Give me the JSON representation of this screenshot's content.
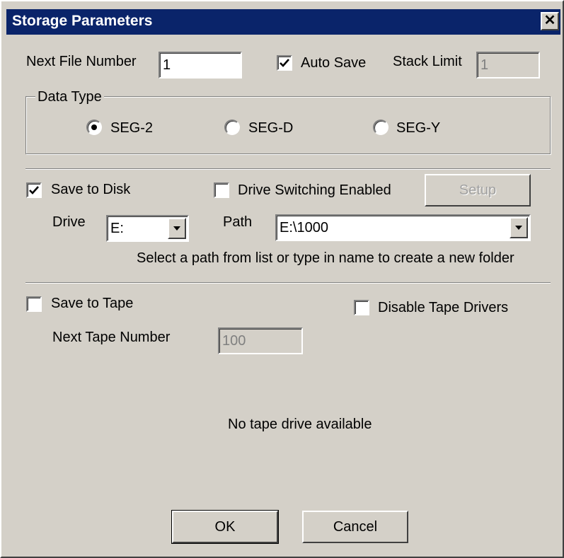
{
  "window": {
    "title": "Storage Parameters",
    "close_glyph": "✕"
  },
  "file": {
    "next_file_label": "Next File Number",
    "next_file_value": "1",
    "auto_save_label": "Auto Save",
    "auto_save_checked": true,
    "stack_limit_label": "Stack Limit",
    "stack_limit_value": "1"
  },
  "data_type": {
    "label": "Data Type",
    "selected": "SEG-2",
    "options": [
      "SEG-2",
      "SEG-D",
      "SEG-Y"
    ]
  },
  "disk": {
    "save_label": "Save to Disk",
    "save_checked": true,
    "drive_switch_label": "Drive Switching Enabled",
    "drive_switch_checked": false,
    "setup_label": "Setup",
    "drive_label": "Drive",
    "drive_value": "E:",
    "path_label": "Path",
    "path_value": "E:\\1000",
    "hint": "Select a path from list or type in name to create a new folder"
  },
  "tape": {
    "save_label": "Save to Tape",
    "save_checked": false,
    "disable_drivers_label": "Disable Tape Drivers",
    "disable_drivers_checked": false,
    "next_tape_label": "Next Tape Number",
    "next_tape_value": "100",
    "status": "No tape drive available"
  },
  "actions": {
    "ok_label": "OK",
    "cancel_label": "Cancel"
  },
  "icons": {
    "check": "check-icon",
    "dropdown": "triangle-down-icon",
    "close": "close-icon"
  }
}
